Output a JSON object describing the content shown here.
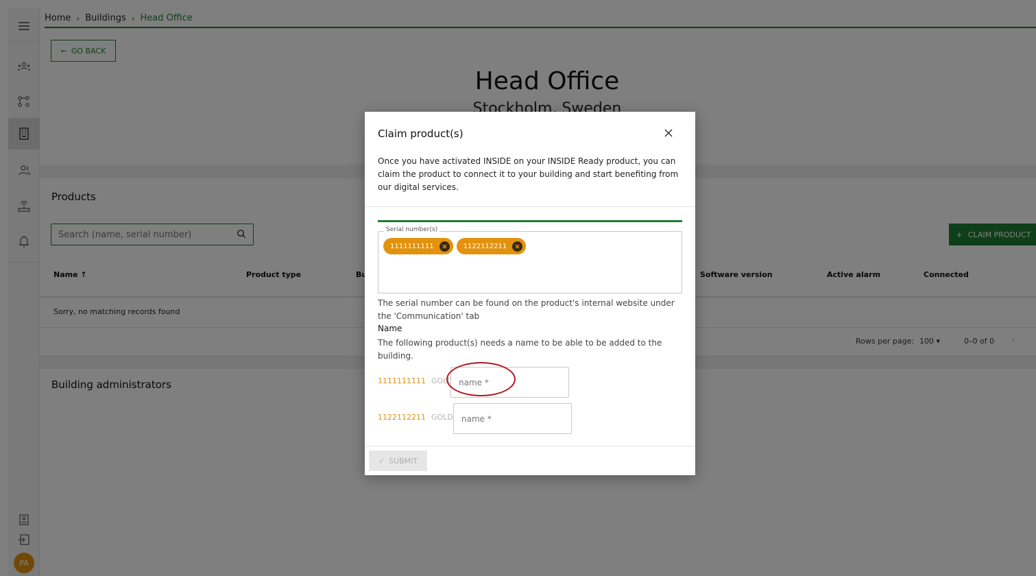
{
  "breadcrumb": {
    "home": "Home",
    "buildings": "Buildings",
    "current": "Head Office"
  },
  "goback_label": "GO BACK",
  "building": {
    "name": "Head Office",
    "location": "Stockholm, Sweden"
  },
  "products": {
    "title": "Products",
    "search_placeholder": "Search (name, serial number)",
    "claim_label": "CLAIM PRODUCT",
    "columns": [
      "Name ↑",
      "Product type",
      "Bu",
      "Software version",
      "Active alarm",
      "Connected"
    ],
    "empty_text": "Sorry, no matching records found",
    "rows_per_page_label": "Rows per page:",
    "rows_per_page_value": "100",
    "range_text": "0–0 of 0"
  },
  "building_admins_title": "Building administrators",
  "avatar_initials": "PA",
  "modal": {
    "title": "Claim product(s)",
    "description": "Once you have activated INSIDE on your INSIDE Ready product, you can claim the product to connect it to your building and start benefiting from our digital services.",
    "serial_legend": "Serial number(s)",
    "chips": [
      "1111111111",
      "1122112211"
    ],
    "serial_help": "The serial number can be found on the product's internal website under the 'Communication' tab",
    "name_label": "Name",
    "name_help": "The following product(s) needs a name to be able to be added to the building.",
    "products": [
      {
        "serial": "1111111111",
        "type": "GOLD",
        "placeholder": "name *"
      },
      {
        "serial": "1122112211",
        "type": "GOLD",
        "placeholder": "name *"
      }
    ],
    "submit_label": "SUBMIT"
  },
  "colors": {
    "primary_green": "#1e7e34",
    "chip_orange": "#e3920f",
    "highlight_red": "#b0161d"
  }
}
